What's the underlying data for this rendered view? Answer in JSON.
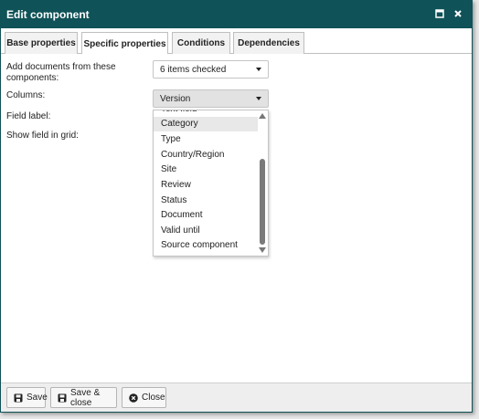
{
  "dialog": {
    "title": "Edit component",
    "maximize_icon": "maximize-icon",
    "close_icon": "close-icon"
  },
  "tabs": [
    {
      "label": "Base properties",
      "active": false
    },
    {
      "label": "Specific properties",
      "active": true
    },
    {
      "label": "Conditions",
      "active": false
    },
    {
      "label": "Dependencies",
      "active": false
    }
  ],
  "form": {
    "add_docs_label": "Add documents from these components:",
    "add_docs_value": "6 items checked",
    "columns_label": "Columns:",
    "columns_value": "Version",
    "field_label_label": "Field label:",
    "show_field_label": "Show field in grid:"
  },
  "dropdown": {
    "partial_item": "Text field",
    "items": [
      "Category",
      "Type",
      "Country/Region",
      "Site",
      "Review",
      "Status",
      "Document",
      "Valid until",
      "Source component"
    ],
    "highlighted": "Category"
  },
  "footer": {
    "save": "Save",
    "save_close": "Save & close",
    "close": "Close"
  },
  "colors": {
    "titlebar": "#0f5257",
    "footer": "#eeeeee"
  }
}
